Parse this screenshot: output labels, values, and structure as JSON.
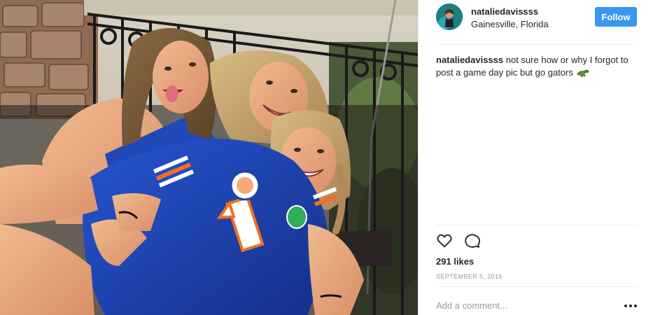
{
  "post": {
    "username": "nataliedavissss",
    "location": "Gainesville, Florida",
    "follow_label": "Follow",
    "caption": {
      "username": "nataliedavissss",
      "text": "not sure how or why I forgot to post a game day pic but go gators",
      "emoji": "gator-emoji"
    },
    "likes": "291 likes",
    "date": "SEPTEMBER 5, 2016",
    "comment": {
      "placeholder": "Add a comment...",
      "value": ""
    },
    "icons": {
      "like": "heart-icon",
      "comment": "comment-bubble-icon",
      "more": "more-options-icon"
    },
    "photo": {
      "jersey_number": "1"
    }
  },
  "colors": {
    "follow_button": "#3897f0",
    "jersey_blue": "#1b45b8",
    "jersey_orange": "#f26f21",
    "text": "#262626",
    "muted": "#999999",
    "divider": "#efefef"
  }
}
